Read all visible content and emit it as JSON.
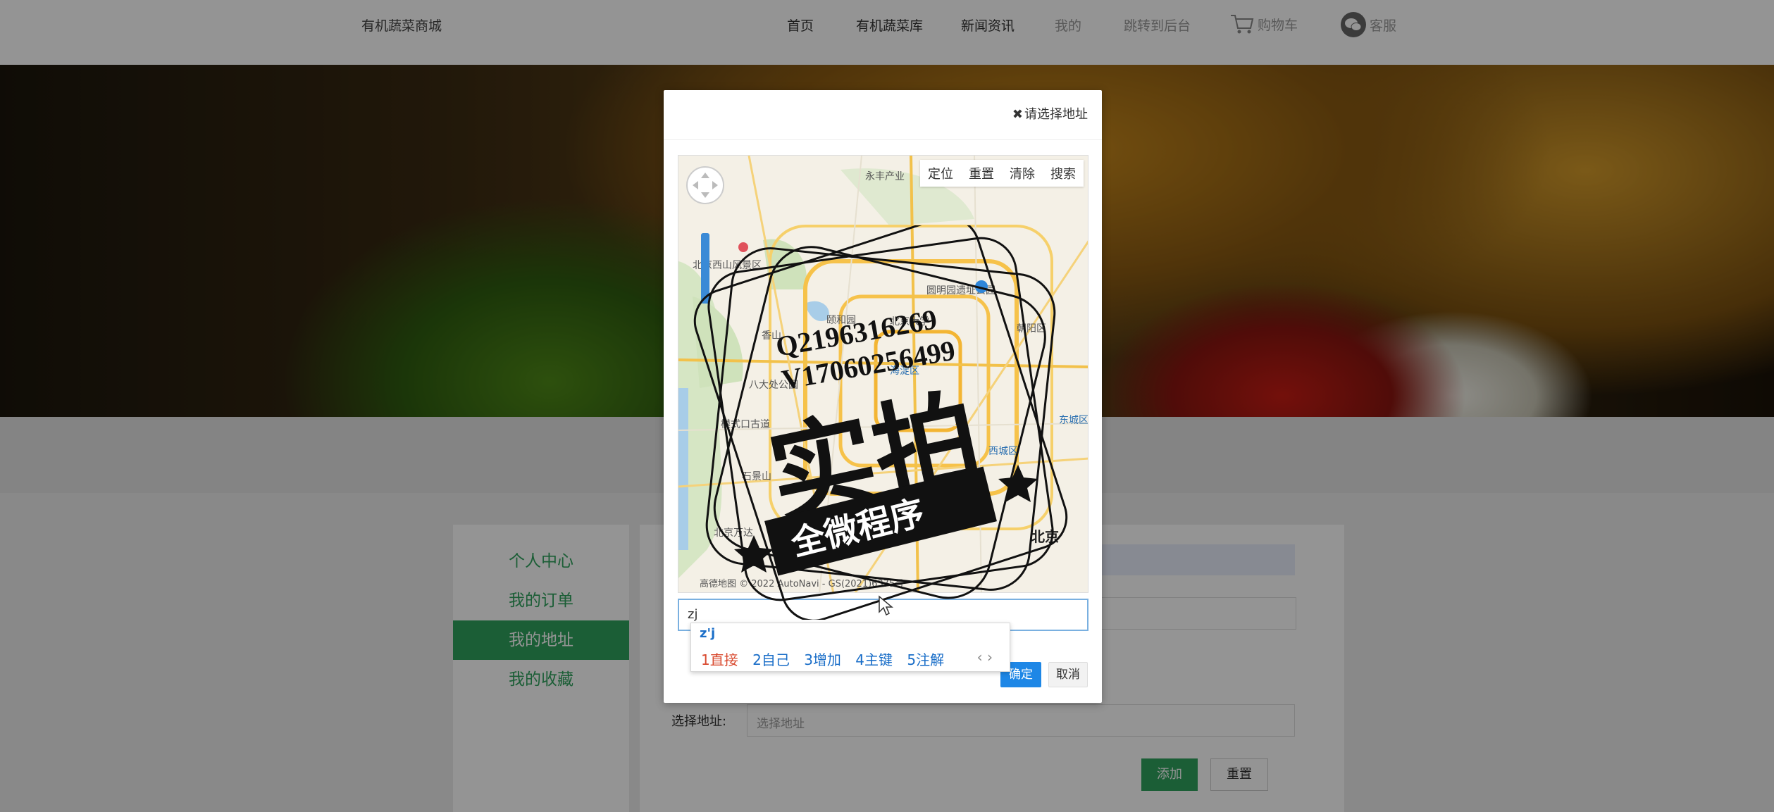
{
  "header": {
    "brand": "有机蔬菜商城",
    "nav": [
      "首页",
      "有机蔬菜库",
      "新闻资讯",
      "我的",
      "跳转到后台",
      "购物车",
      "客服"
    ]
  },
  "sidebar": {
    "items": [
      "个人中心",
      "我的订单",
      "我的地址",
      "我的收藏"
    ],
    "active_index": 2
  },
  "form": {
    "select_address_label": "选择地址:",
    "select_address_placeholder": "选择地址",
    "add_button": "添加",
    "reset_button": "重置"
  },
  "modal": {
    "title": "请选择地址",
    "map_tools": [
      "定位",
      "重置",
      "清除",
      "搜索"
    ],
    "map_credit": "高德地图 © 2022 AutoNavi - GS(2021)6375号",
    "address_input_value": "zj",
    "ok_button": "确定",
    "cancel_button": "取消"
  },
  "map_labels": [
    "永丰产业",
    "北京西山风景区",
    "香山",
    "颐和园",
    "圆明园遗址公园",
    "北京大学",
    "八大处公园",
    "海淀区",
    "西城区",
    "东城区",
    "朝阳区",
    "模式口古道",
    "石景山",
    "北京万达",
    "北京"
  ],
  "ime": {
    "composition": "z'j",
    "candidates": [
      "1直接",
      "2自己",
      "3增加",
      "4主键",
      "5注解"
    ]
  },
  "watermark": {
    "line1": "Q2196316269",
    "line2": "V17060256499",
    "main": "实拍",
    "banner": "全微程序"
  }
}
